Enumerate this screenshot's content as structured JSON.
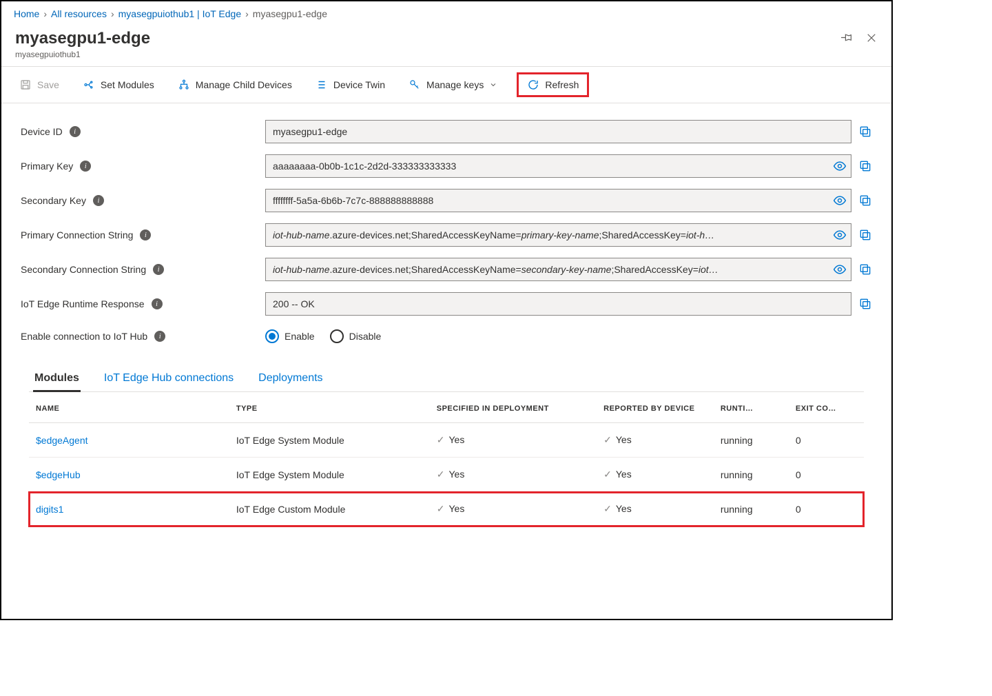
{
  "breadcrumb": {
    "items": [
      "Home",
      "All resources",
      "myasegpuiothub1 | IoT Edge",
      "myasegpu1-edge"
    ]
  },
  "title": "myasegpu1-edge",
  "subtitle": "myasegpuiothub1",
  "toolbar": {
    "save": "Save",
    "setModules": "Set Modules",
    "manageChild": "Manage Child Devices",
    "deviceTwin": "Device Twin",
    "manageKeys": "Manage keys",
    "refresh": "Refresh"
  },
  "fields": {
    "deviceId": {
      "label": "Device ID",
      "value": "myasegpu1-edge"
    },
    "primaryKey": {
      "label": "Primary Key",
      "value": "aaaaaaaa-0b0b-1c1c-2d2d-333333333333"
    },
    "secondaryKey": {
      "label": "Secondary Key",
      "value": "ffffffff-5a5a-6b6b-7c7c-888888888888"
    },
    "primaryConn": {
      "label": "Primary Connection String",
      "seg1": "iot-hub-name",
      "seg2": ".azure-devices.net;SharedAccessKeyName=",
      "seg3": "primary-key-name",
      "seg4": ";SharedAccessKey=",
      "seg5": "iot-h…"
    },
    "secondaryConn": {
      "label": "Secondary Connection String",
      "seg1": "iot-hub-name",
      "seg2": ".azure-devices.net;SharedAccessKeyName=",
      "seg3": "secondary-key-name",
      "seg4": ";SharedAccessKey=",
      "seg5": "iot…"
    },
    "runtimeResponse": {
      "label": "IoT Edge Runtime Response",
      "value": "200 -- OK"
    },
    "enableConn": {
      "label": "Enable connection to IoT Hub",
      "enable": "Enable",
      "disable": "Disable"
    }
  },
  "tabs": {
    "modules": "Modules",
    "connections": "IoT Edge Hub connections",
    "deployments": "Deployments"
  },
  "table": {
    "headers": {
      "name": "NAME",
      "type": "TYPE",
      "spec": "SPECIFIED IN DEPLOYMENT",
      "rep": "REPORTED BY DEVICE",
      "run": "RUNTI…",
      "exit": "EXIT CO…"
    },
    "yes": "Yes",
    "rows": [
      {
        "name": "$edgeAgent",
        "type": "IoT Edge System Module",
        "run": "running",
        "exit": "0"
      },
      {
        "name": "$edgeHub",
        "type": "IoT Edge System Module",
        "run": "running",
        "exit": "0"
      },
      {
        "name": "digits1",
        "type": "IoT Edge Custom Module",
        "run": "running",
        "exit": "0"
      }
    ]
  }
}
